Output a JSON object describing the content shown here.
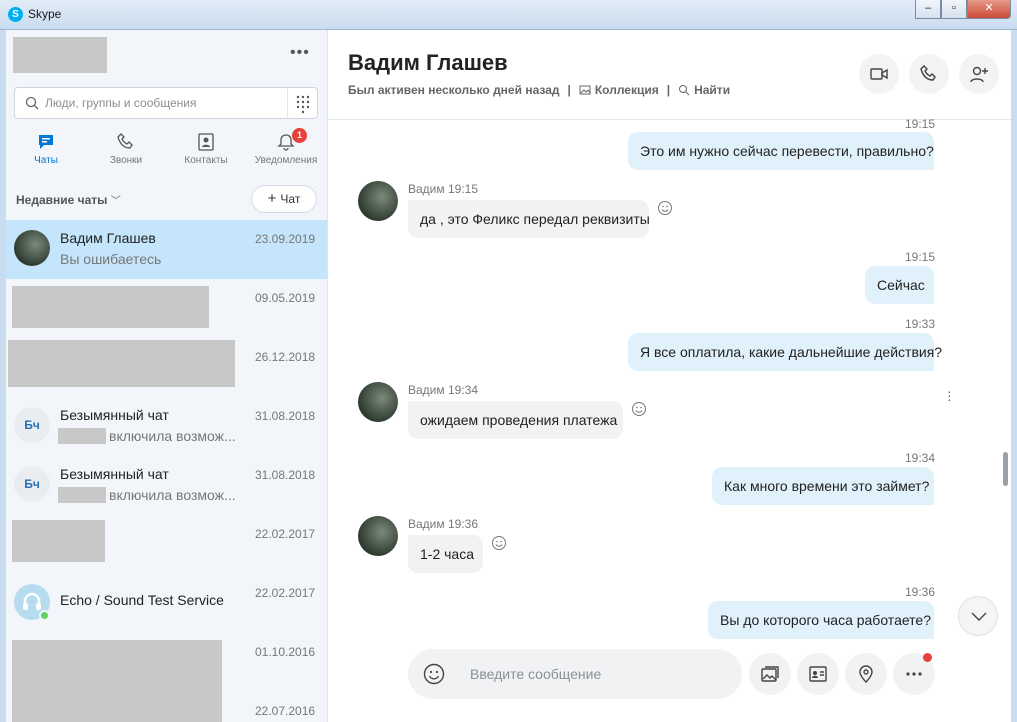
{
  "window": {
    "title": "Skype"
  },
  "sidebar": {
    "search_placeholder": "Люди, группы и сообщения",
    "nav": [
      {
        "label": "Чаты",
        "icon": "chat-icon"
      },
      {
        "label": "Звонки",
        "icon": "phone-icon"
      },
      {
        "label": "Контакты",
        "icon": "contacts-icon"
      },
      {
        "label": "Уведомления",
        "icon": "bell-icon",
        "badge": "1"
      }
    ],
    "recent_label": "Недавние чаты",
    "new_chat_label": "Чат",
    "chats": [
      {
        "name": "Вадим Глашев",
        "preview": "Вы ошибаетесь",
        "date": "23.09.2019"
      },
      {
        "name": "",
        "preview": "",
        "date": "09.05.2019"
      },
      {
        "name": "",
        "preview": "",
        "date": "26.12.2018"
      },
      {
        "name": "Безымянный чат",
        "initials": "Бч",
        "preview": "включила возмож...",
        "date": "31.08.2018"
      },
      {
        "name": "Безымянный чат",
        "initials": "Бч",
        "preview": "включила возмож...",
        "date": "31.08.2018"
      },
      {
        "name": "",
        "preview": "",
        "date": "22.02.2017"
      },
      {
        "name": "Echo / Sound Test Service",
        "preview": "",
        "date": "22.02.2017"
      },
      {
        "name": "",
        "preview": "",
        "date": "01.10.2016"
      },
      {
        "name": "",
        "preview": "",
        "date": "22.07.2016"
      }
    ]
  },
  "conversation": {
    "title": "Вадим Глашев",
    "status": "Был активен несколько дней назад",
    "gallery_label": "Коллекция",
    "find_label": "Найти",
    "messages": [
      {
        "dir": "out",
        "time": "19:15",
        "text": "Это им нужно сейчас перевести, правильно?"
      },
      {
        "dir": "in",
        "sender": "Вадим",
        "time": "19:15",
        "text": "да , это Феликс передал реквизиты"
      },
      {
        "dir": "out",
        "time": "19:15",
        "text": "Сейчас"
      },
      {
        "dir": "out",
        "time": "19:33",
        "text": "Я все оплатила, какие дальнейшие действия?"
      },
      {
        "dir": "in",
        "sender": "Вадим",
        "time": "19:34",
        "text": "ожидаем проведения платежа"
      },
      {
        "dir": "out",
        "time": "19:34",
        "text": "Как много времени это займет?"
      },
      {
        "dir": "in",
        "sender": "Вадим",
        "time": "19:36",
        "text": "1-2 часа"
      },
      {
        "dir": "out",
        "time": "19:36",
        "text": "Вы до которого часа работаете?"
      }
    ],
    "composer_placeholder": "Введите сообщение"
  },
  "colors": {
    "accent": "#0078d4",
    "active_chat": "#c4e5fb",
    "out_bubble": "#e0f1fc",
    "badge": "#e8403a"
  }
}
